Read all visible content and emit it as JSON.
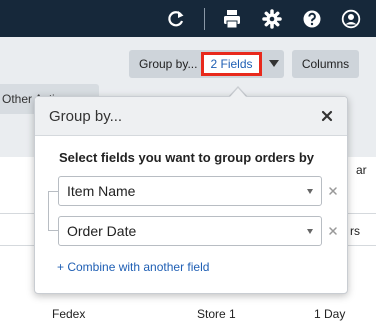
{
  "topbar": {
    "icons": [
      "refresh-icon",
      "print-icon",
      "gear-icon",
      "help-icon",
      "user-icon"
    ]
  },
  "toolbar": {
    "other_actions_label": "Other Actions",
    "group_by_label": "Group by...",
    "group_by_value": "2 Fields",
    "columns_label": "Columns"
  },
  "popover": {
    "title": "Group by...",
    "instruction": "Select fields you want to group orders by",
    "fields": [
      "Item Name",
      "Order Date"
    ],
    "combine_link": "+ Combine with another field"
  },
  "table": {
    "header_fragment": "ar",
    "row1_fragment": "rs",
    "row2": [
      "Fedex",
      "Store 1",
      "1 Day"
    ]
  },
  "colors": {
    "topbar": "#16283a",
    "highlight_border": "#e8291c",
    "link": "#1f5fb4"
  }
}
